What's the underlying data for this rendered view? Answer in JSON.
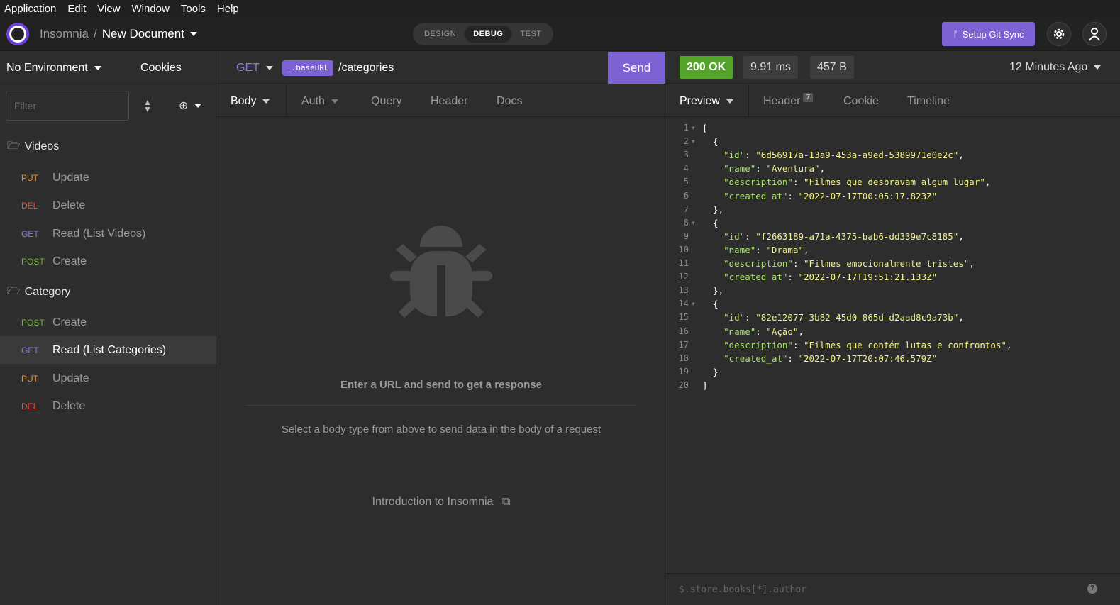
{
  "menubar": [
    "Application",
    "Edit",
    "View",
    "Window",
    "Tools",
    "Help"
  ],
  "header": {
    "app_name": "Insomnia",
    "separator": "/",
    "document": "New Document",
    "modes": [
      "DESIGN",
      "DEBUG",
      "TEST"
    ],
    "active_mode": "DEBUG",
    "git_sync": "Setup Git Sync",
    "brand_color": "#7d62d6"
  },
  "sidebar": {
    "environment": "No Environment",
    "cookies": "Cookies",
    "filter_placeholder": "Filter",
    "folders": [
      {
        "name": "Videos",
        "requests": [
          {
            "method": "PUT",
            "name": "Update"
          },
          {
            "method": "DEL",
            "name": "Delete"
          },
          {
            "method": "GET",
            "name": "Read (List Videos)"
          },
          {
            "method": "POST",
            "name": "Create"
          }
        ]
      },
      {
        "name": "Category",
        "requests": [
          {
            "method": "POST",
            "name": "Create"
          },
          {
            "method": "GET",
            "name": "Read (List Categories)"
          },
          {
            "method": "PUT",
            "name": "Update"
          },
          {
            "method": "DEL",
            "name": "Delete"
          }
        ]
      }
    ],
    "method_colors": {
      "GET": "#8a7be2",
      "POST": "#6cba2e",
      "PUT": "#e8922e",
      "DEL": "#e5504a"
    }
  },
  "request": {
    "method": "GET",
    "base_tag": "_.baseURL",
    "path": "/categories",
    "send": "Send",
    "tabs": [
      "Body",
      "Auth",
      "Query",
      "Header",
      "Docs"
    ],
    "empty_title": "Enter a URL and send to get a response",
    "body_hint": "Select a body type from above to send data in the body of a request",
    "intro_link": "Introduction to Insomnia"
  },
  "response": {
    "status_code": "200",
    "status_text": "OK",
    "time": "9.91 ms",
    "size": "457 B",
    "ago": "12 Minutes Ago",
    "tabs": [
      "Preview",
      "Header",
      "Cookie",
      "Timeline"
    ],
    "header_count": "7",
    "filter_placeholder": "$.store.books[*].author",
    "help": "?",
    "items": [
      {
        "id": "6d56917a-13a9-453a-a9ed-5389971e0e2c",
        "name": "Aventura",
        "description": "Filmes que desbravam algum lugar",
        "created_at": "2022-07-17T00:05:17.823Z"
      },
      {
        "id": "f2663189-a71a-4375-bab6-dd339e7c8185",
        "name": "Drama",
        "description": "Filmes emocionalmente tristes",
        "created_at": "2022-07-17T19:51:21.133Z"
      },
      {
        "id": "82e12077-3b82-45d0-865d-d2aad8c9a73b",
        "name": "Ação",
        "description": "Filmes que contém lutas e confrontos",
        "created_at": "2022-07-17T20:07:46.579Z"
      }
    ]
  }
}
